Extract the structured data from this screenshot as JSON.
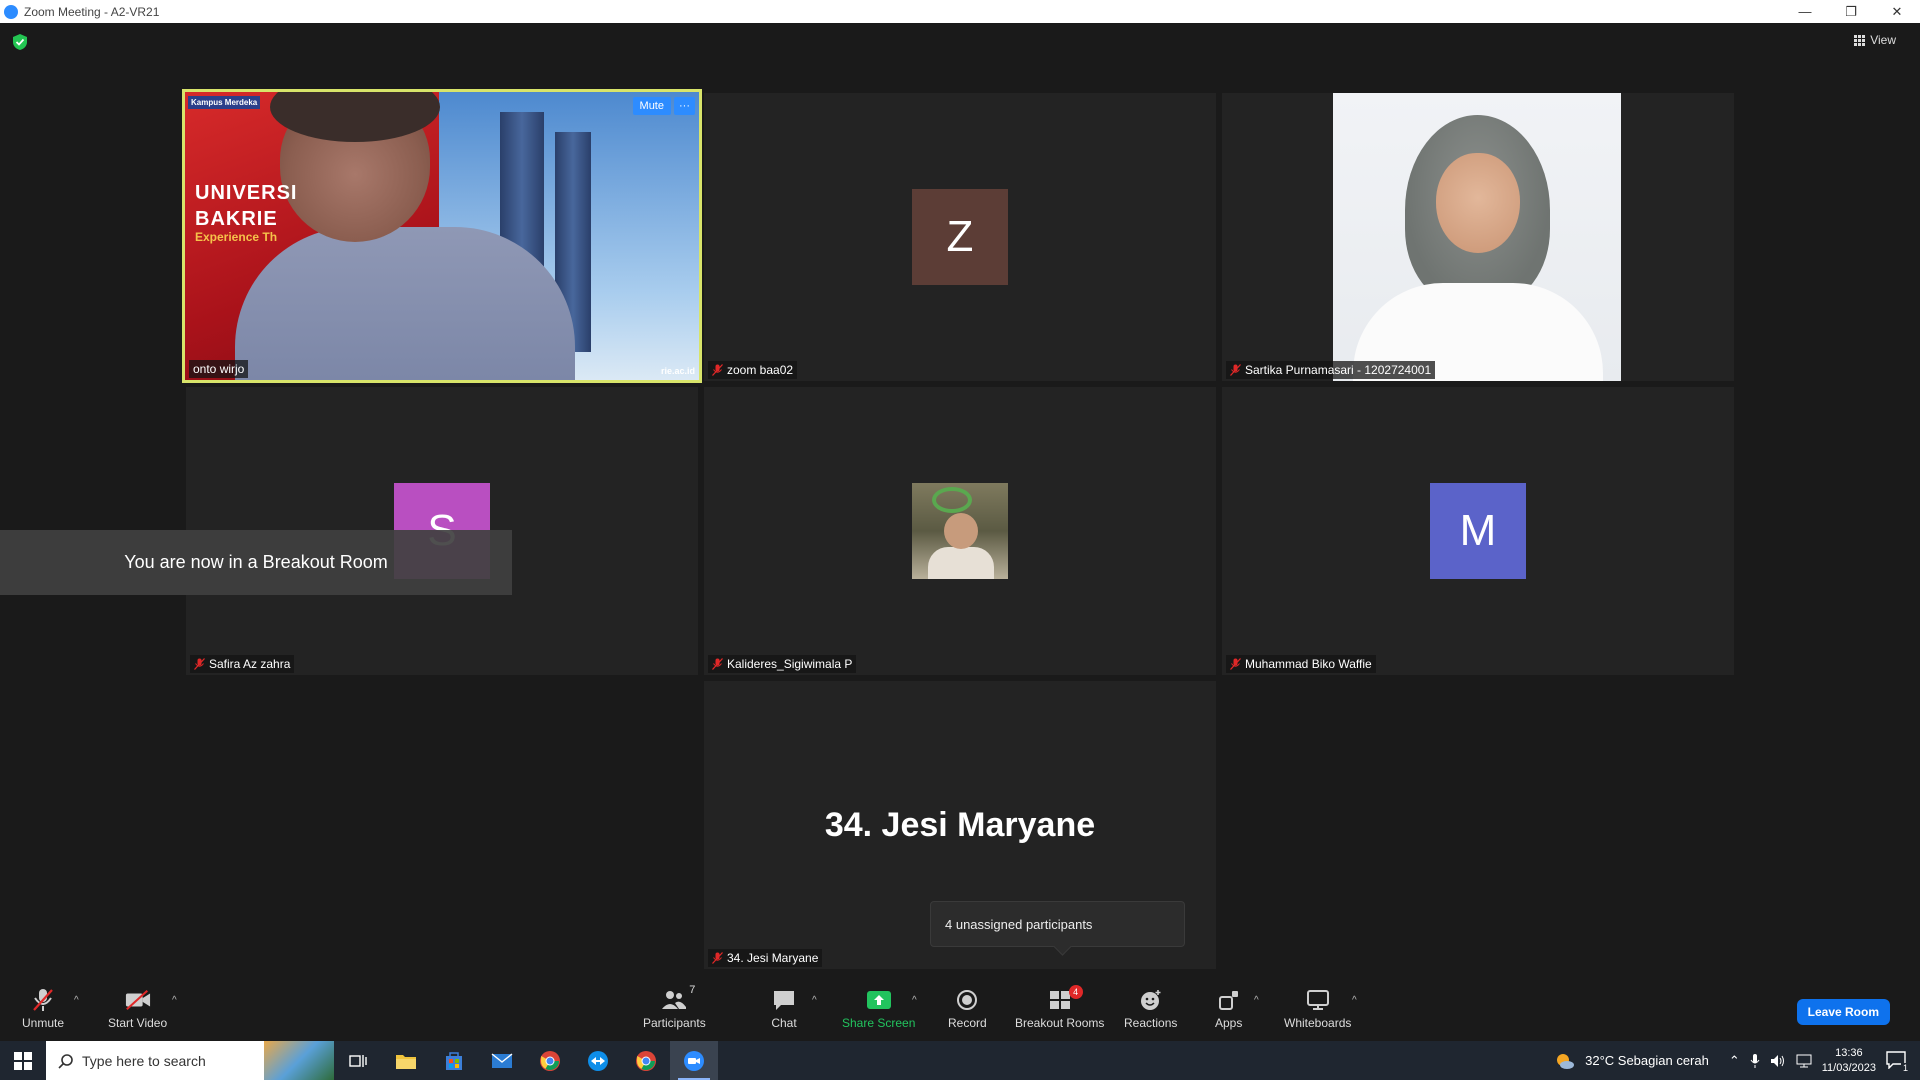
{
  "window": {
    "title": "Zoom Meeting - A2-VR21"
  },
  "header": {
    "view_label": "View"
  },
  "tiles": [
    {
      "name": "onto wirjo",
      "mute_label": "Mute",
      "more_label": "···",
      "banner_line1": "UNIVERSI",
      "banner_line2": "BAKRIE",
      "banner_sub": "Experience Th",
      "brand": "Kampus Merdeka",
      "url": "rie.ac.id"
    },
    {
      "name": "zoom baa02",
      "initial": "Z",
      "color": "#5c3d36"
    },
    {
      "name": "Sartika Purnamasari - 1202724001"
    },
    {
      "name": "Safira Az zahra",
      "initial": "S",
      "color": "#b94fc1"
    },
    {
      "name": "Kalideres_Sigiwimala P"
    },
    {
      "name": "Muhammad Biko Waffie",
      "initial": "M",
      "color": "#5b63c9"
    },
    {
      "name": "34. Jesi Maryane",
      "display_name": "34. Jesi Maryane"
    }
  ],
  "toast": {
    "text": "You are now in a Breakout Room"
  },
  "tooltip": {
    "text": "4 unassigned participants"
  },
  "toolbar": {
    "unmute": "Unmute",
    "start_video": "Start Video",
    "participants": "Participants",
    "participants_count": "7",
    "chat": "Chat",
    "share_screen": "Share Screen",
    "record": "Record",
    "breakout_rooms": "Breakout Rooms",
    "breakout_badge": "4",
    "reactions": "Reactions",
    "apps": "Apps",
    "whiteboards": "Whiteboards",
    "leave": "Leave Room"
  },
  "taskbar": {
    "search_placeholder": "Type here to search",
    "weather": "32°C  Sebagian cerah",
    "time": "13:36",
    "date": "11/03/2023",
    "notif_count": "1"
  },
  "colors": {
    "accent": "#2d8cff",
    "active_border": "#d8e46a",
    "share_green": "#22c35e",
    "leave_blue": "#0e72ed"
  }
}
